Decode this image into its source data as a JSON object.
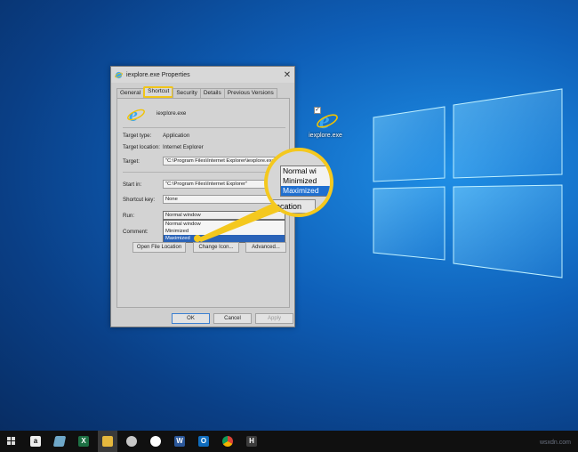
{
  "desktop": {
    "icon_label": "iexplore.exe"
  },
  "dialog": {
    "title": "iexplore.exe Properties",
    "close_symbol": "✕",
    "tabs": [
      {
        "label": "General"
      },
      {
        "label": "Shortcut"
      },
      {
        "label": "Security"
      },
      {
        "label": "Details"
      },
      {
        "label": "Previous Versions"
      }
    ],
    "app_name": "iexplore.exe",
    "target_type_label": "Target type:",
    "target_type_value": "Application",
    "target_location_label": "Target location:",
    "target_location_value": "Internet Explorer",
    "target_label": "Target:",
    "target_value": "\"C:\\Program Files\\Internet Explorer\\iexplore.exe\"",
    "start_in_label": "Start in:",
    "start_in_value": "\"C:\\Program Files\\Internet Explorer\"",
    "shortcut_key_label": "Shortcut key:",
    "shortcut_key_value": "None",
    "run_label": "Run:",
    "run_value": "Normal window",
    "run_options": [
      "Normal window",
      "Minimized",
      "Maximized"
    ],
    "run_highlighted": "Maximized",
    "comment_label": "Comment:",
    "open_file_location": "Open File Location",
    "change_icon": "Change Icon...",
    "advanced": "Advanced...",
    "ok": "OK",
    "cancel": "Cancel",
    "apply": "Apply"
  },
  "magnifier": {
    "options": [
      "Normal wi",
      "Minimized",
      "Maximized"
    ],
    "button_fragment": "ocation"
  },
  "taskbar": {
    "icons": [
      "start-icon",
      "amazon-icon",
      "files-icon",
      "excel-icon",
      "file-explorer-icon",
      "paint-icon",
      "photos-icon",
      "word-icon",
      "outlook-icon",
      "chrome-icon",
      "app-icon"
    ]
  },
  "watermark": "wsxdn.com",
  "colors": {
    "highlight": "#f4c81e",
    "selection": "#2a63b8",
    "desktop": "#0e5fb8"
  }
}
